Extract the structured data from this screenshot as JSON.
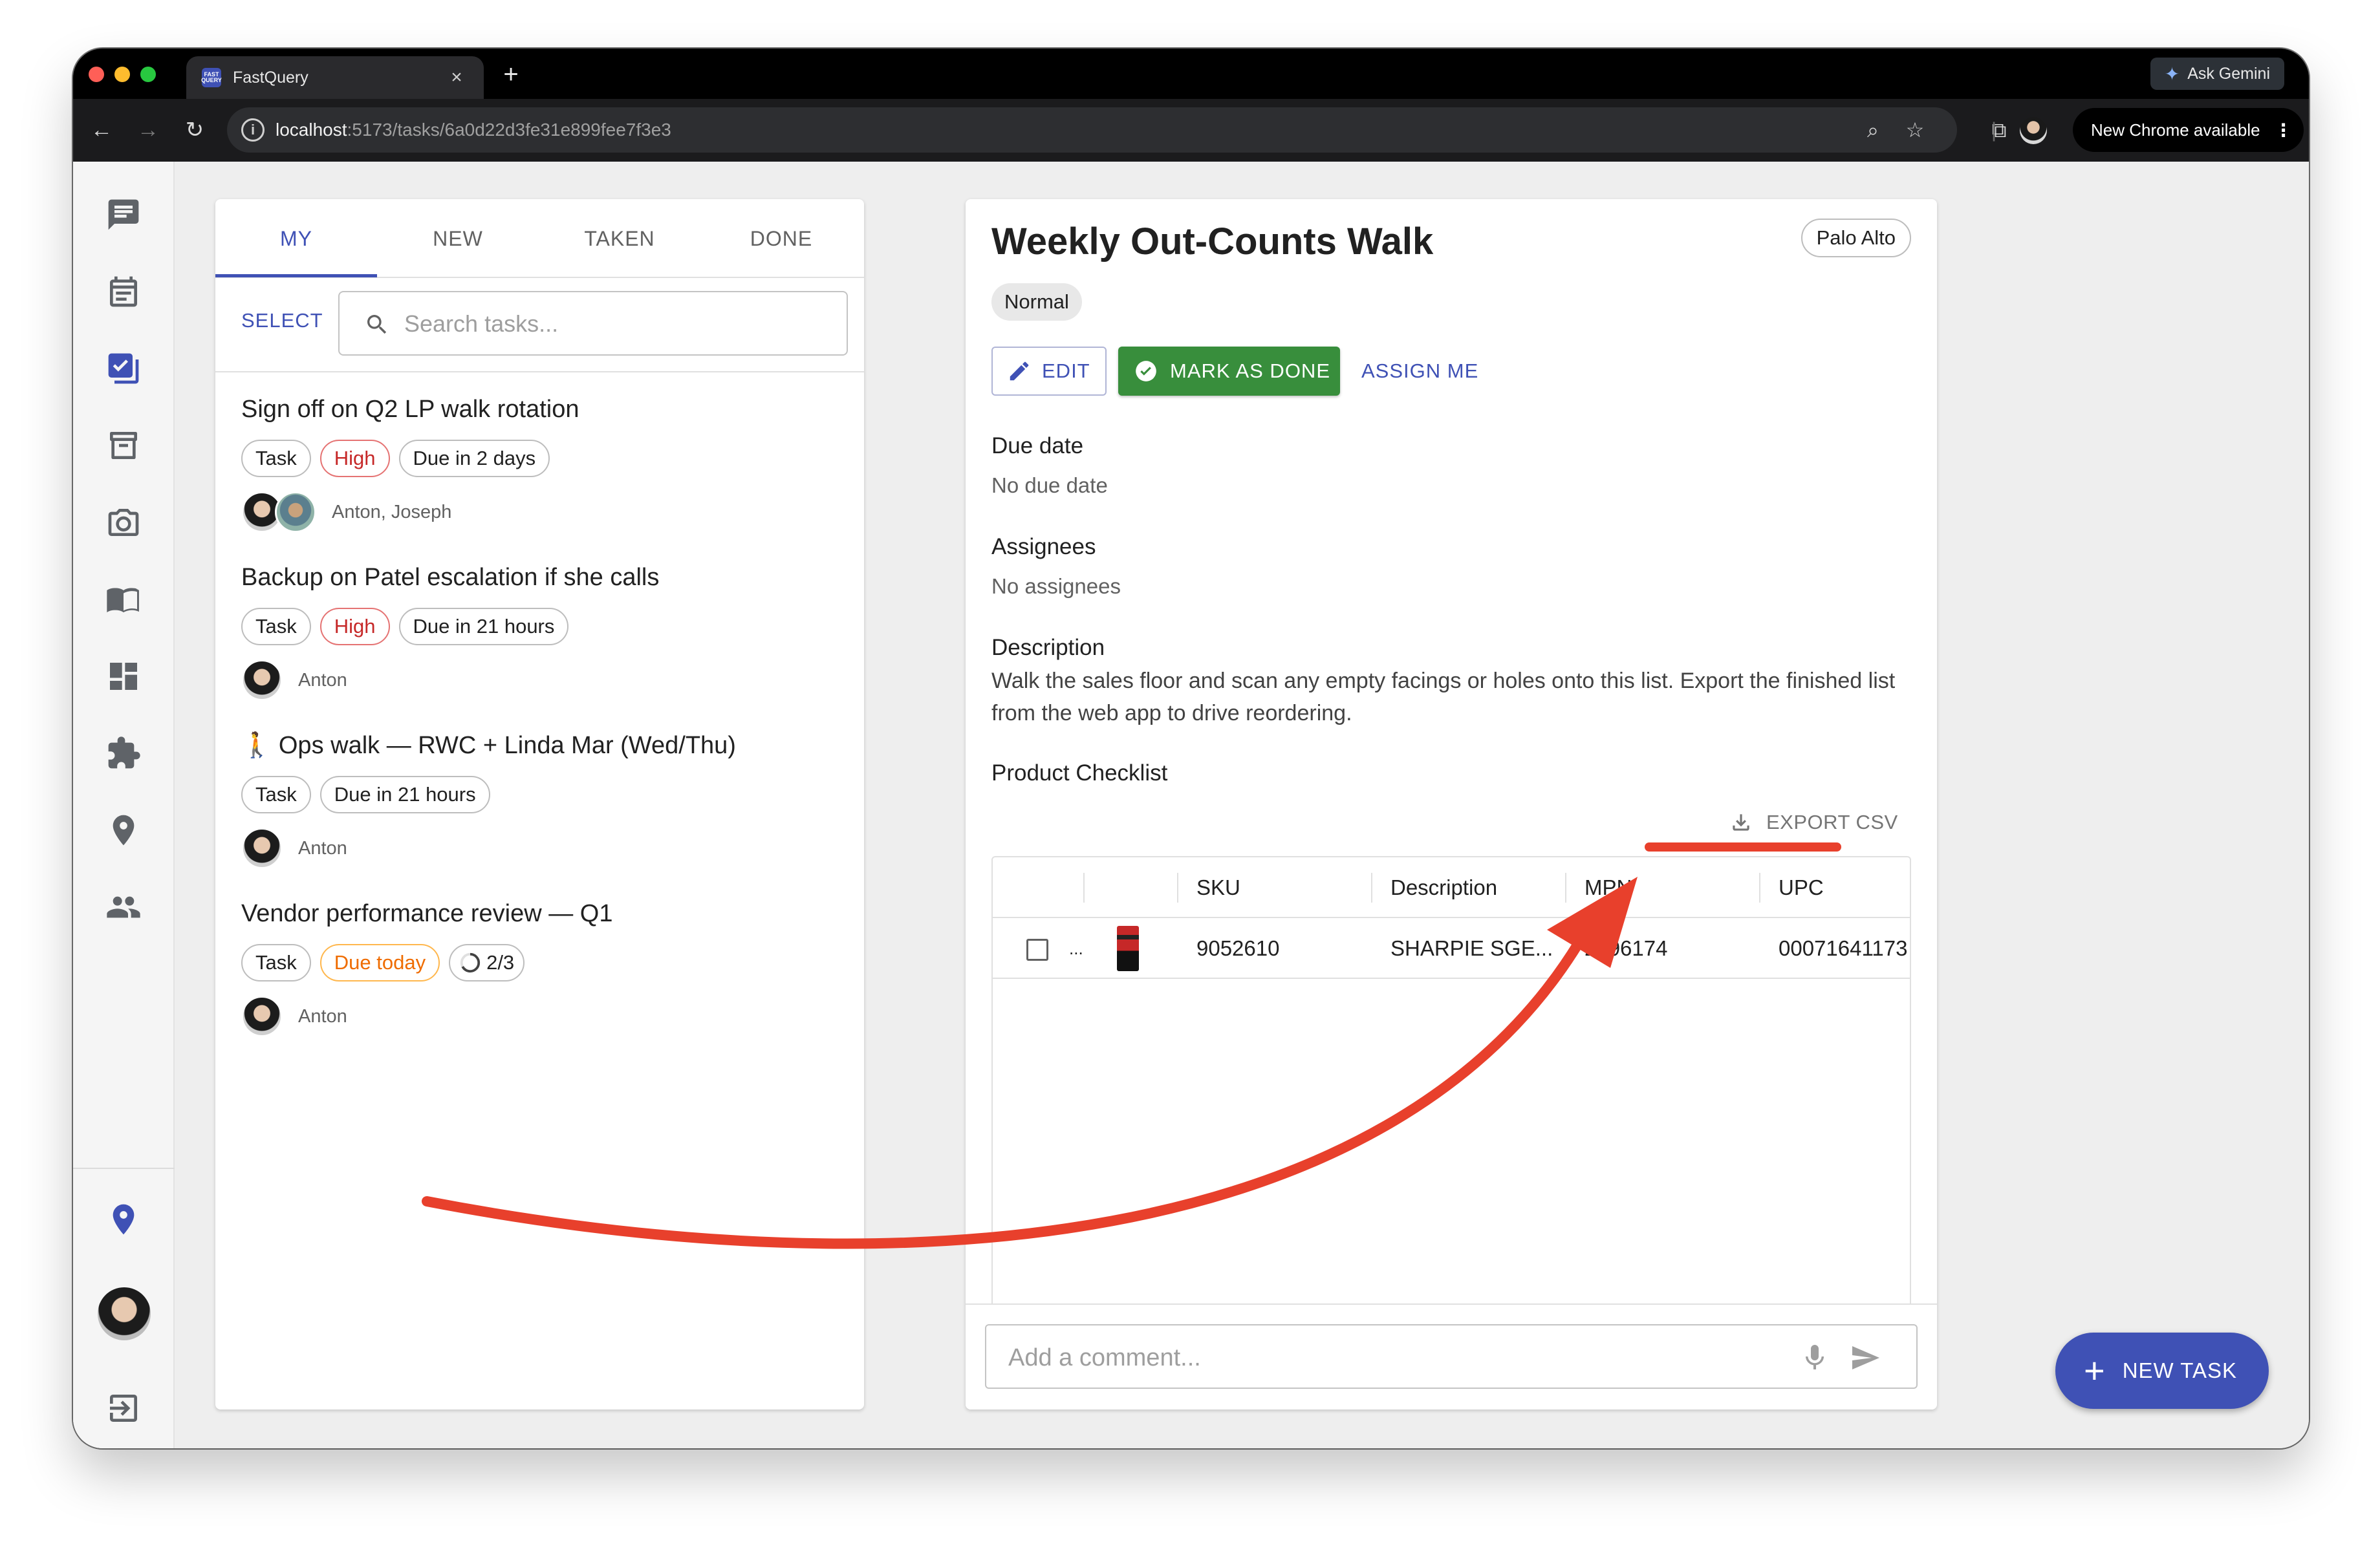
{
  "browser": {
    "tab_title": "FastQuery",
    "favicon_text": "FAST QUERY",
    "new_tab_label": "+",
    "close_tab_label": "×",
    "gemini_label": "Ask Gemini",
    "url_host": "localhost",
    "url_path": ":5173/tasks/6a0d22d3fe31e899fee7f3e3",
    "update_label": "New Chrome available"
  },
  "task_list": {
    "tabs": [
      "MY",
      "NEW",
      "TAKEN",
      "DONE"
    ],
    "active_tab": "MY",
    "select_label": "SELECT",
    "search_placeholder": "Search tasks...",
    "tasks": [
      {
        "title": "Sign off on Q2 LP walk rotation",
        "type": "Task",
        "priority": "High",
        "due": "Due in 2 days",
        "assignees": "Anton, Joseph"
      },
      {
        "title": "Backup on Patel escalation if she calls",
        "type": "Task",
        "priority": "High",
        "due": "Due in 21 hours",
        "assignees": "Anton"
      },
      {
        "title": "🚶 Ops walk — RWC + Linda Mar (Wed/Thu)",
        "type": "Task",
        "due": "Due in 21 hours",
        "assignees": "Anton"
      },
      {
        "title": "Vendor performance review — Q1",
        "type": "Task",
        "due": "Due today",
        "progress": "2/3",
        "progress_fraction": 0.67,
        "assignees": "Anton"
      }
    ]
  },
  "detail": {
    "title": "Weekly Out-Counts Walk",
    "location": "Palo Alto",
    "priority": "Normal",
    "edit_label": "EDIT",
    "mark_done_label": "MARK AS DONE",
    "assign_label": "ASSIGN ME",
    "due_label": "Due date",
    "due_value": "No due date",
    "assignees_label": "Assignees",
    "assignees_value": "No assignees",
    "description_label": "Description",
    "description_text": "Walk the sales floor and scan any empty facings or holes onto this list. Export the finished list from the web app to drive reordering.",
    "checklist_label": "Product Checklist",
    "export_label": "EXPORT CSV",
    "columns": [
      "SKU",
      "Description",
      "MPN",
      "UPC"
    ],
    "rows": [
      {
        "more": "...",
        "sku": "9052610",
        "description": "SHARPIE SGE...",
        "mpn": "2096174",
        "upc": "00071641173"
      }
    ],
    "comment_placeholder": "Add a comment..."
  },
  "fab_label": "NEW TASK",
  "colors": {
    "primary": "#3f51b5",
    "done_green": "#388e3c",
    "high_red": "#c62828",
    "due_today_orange": "#ef6c00",
    "annotation_red": "#e8402c"
  },
  "icons": {
    "rail": [
      "chat-icon",
      "calendar-icon",
      "tasks-checkbox-icon",
      "archive-icon",
      "camera-icon",
      "book-icon",
      "dashboard-icon",
      "extension-icon",
      "location-pin-icon",
      "people-icon"
    ],
    "rail_bottom": [
      "location-pin-icon",
      "avatar",
      "logout-icon"
    ]
  }
}
